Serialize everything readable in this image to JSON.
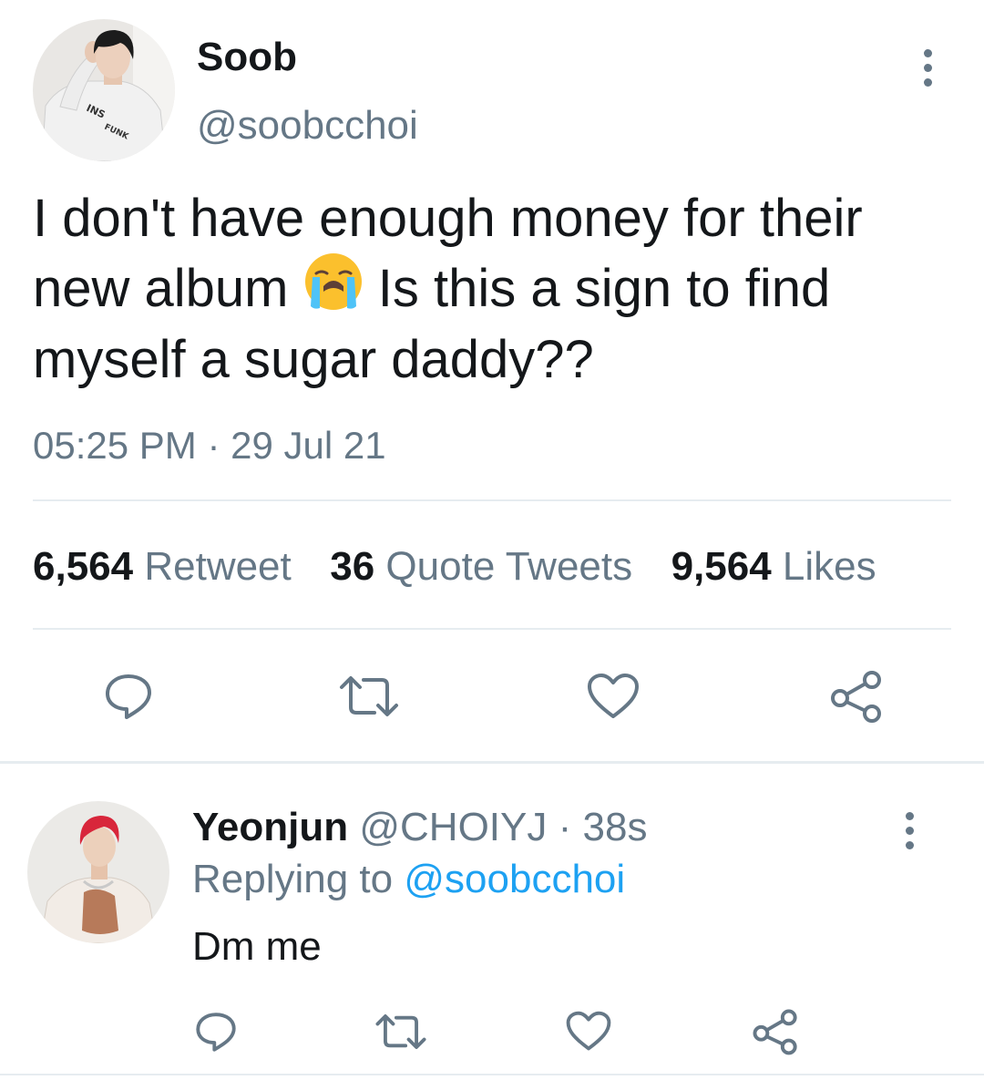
{
  "main_tweet": {
    "author_name": "Soob",
    "author_handle": "@soobcchoi",
    "text_before_emoji": "I don't have enough money for their new album",
    "emoji": "loudly-crying-face",
    "text_after_emoji": "Is this a sign to find myself a sugar daddy??",
    "time": "05:25 PM",
    "separator": "·",
    "date": "29 Jul 21",
    "stats": {
      "retweets_count": "6,564",
      "retweets_label": "Retweet",
      "quotes_count": "36",
      "quotes_label": "Quote Tweets",
      "likes_count": "9,564",
      "likes_label": "Likes"
    },
    "actions": [
      "reply-icon",
      "retweet-icon",
      "like-icon",
      "share-icon"
    ]
  },
  "reply_tweet": {
    "author_name": "Yeonjun",
    "author_handle": "@CHOIYJ",
    "separator": "·",
    "time_ago": "38s",
    "replying_label": "Replying to",
    "replying_handle": "@soobcchoi",
    "text": "Dm me",
    "actions": [
      "reply-icon",
      "retweet-icon",
      "like-icon",
      "share-icon"
    ]
  },
  "colors": {
    "text": "#14171a",
    "secondary": "#657786",
    "link": "#1da1f2",
    "divider": "#e6ecf0"
  }
}
